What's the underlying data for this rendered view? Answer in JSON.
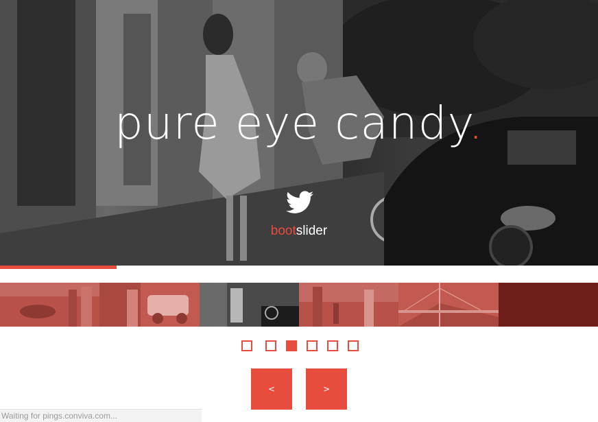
{
  "hero": {
    "title": "pure eye candy",
    "title_dot": ".",
    "brand_accent": "boot",
    "brand_rest": "slider",
    "social_icon": "twitter-bird-icon",
    "accent_color": "#e74c3c"
  },
  "progress": {
    "fraction": 0.195
  },
  "thumbnails": [
    {
      "label": ""
    },
    {
      "label": ""
    },
    {
      "label": ""
    },
    {
      "label": ""
    },
    {
      "label": ""
    },
    {
      "label": ""
    }
  ],
  "pagination": {
    "count": 6,
    "active_index": 2
  },
  "nav": {
    "prev_label": "<",
    "next_label": ">"
  },
  "status_bar": {
    "text": "Waiting for pings.conviva.com..."
  }
}
